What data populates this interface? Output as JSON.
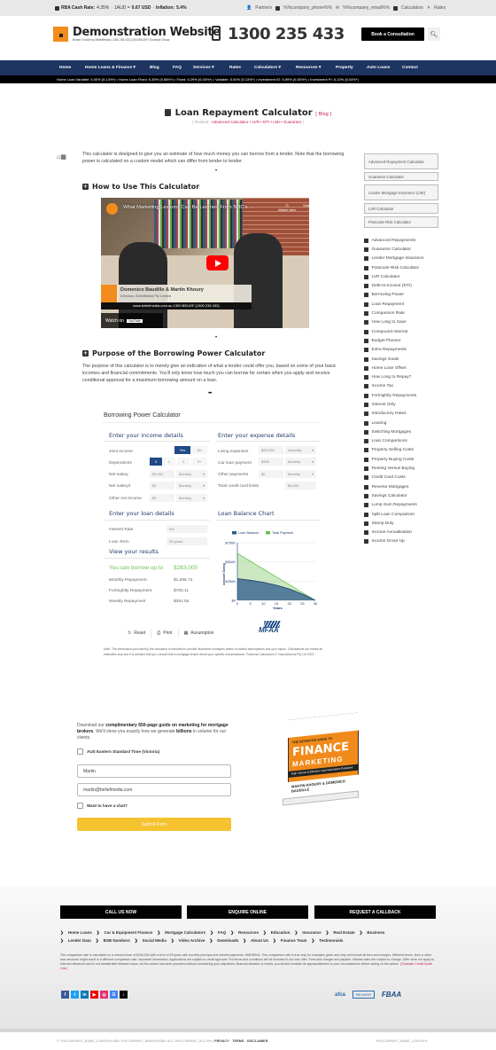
{
  "topbar": {
    "rba_label": "RBA Cash Rate:",
    "rba_value": "4.35%",
    "aud_label": "1AUD =",
    "aud_value": "0.67 USD",
    "inflation_label": "Inflation:",
    "inflation_value": "5.4%",
    "links": [
      "Partners",
      "%%company_phone%%",
      "%%company_email%%",
      "Calculators",
      "Rates"
    ]
  },
  "header": {
    "site_title": "Demonstration Website",
    "site_subtitle": "Broker Growth by BeliefMedia | 1300 235 433 (1300 BELIEF) Example Group",
    "phone": "1300 235 433",
    "book_button": "Book a Consultation",
    "search_icon": "search-icon"
  },
  "nav": {
    "items": [
      "Home",
      "Home Loans & Finance ▾",
      "Blog",
      "FAQ",
      "Services ▾",
      "Rates",
      "Calculators ▾",
      "Resources ▾",
      "Property",
      "Auto Loans",
      "Contact"
    ]
  },
  "ticker": {
    "text": "Home Loan Variable: 5.00% (5.13%*) • Home Loan Fixed: 5.39% (5.68%*) • Fixed: 5.29% (6.03%*) • Variable: 5.00% (5.13%*) • Investment IO: 5.59% (6.50%*) • Investment PI: 5.10% (6.04%*)"
  },
  "page": {
    "title": "Loan Repayment Calculator",
    "blog_tag": "[ Blog ]",
    "related_prefix": "[ Related :",
    "related_links": "Advanced Calculator • LVR • DTI • LMI • Guarantor",
    "related_suffix": "]",
    "intro": "This calculator is designed to give you an estimate of how much money you can borrow from a lender. Note that the borrowing power is calculated on a custom model which can differ from lender to lender.",
    "how_to_heading": "How to Use This Calculator",
    "purpose_heading": "Purpose of the Borrowing Power Calculator",
    "purpose_text": "The purpose of this calculator is to merely give an indication of what a lender could offer you, based on some of your basic incomes and financial commitments. You'll only know how much you can borrow for certain when you apply and receive conditional approval for a maximum borrowing amount on a loan.",
    "bullet": "•",
    "ellipsis": "•••"
  },
  "video": {
    "title": "What Marketing Lessons Can Be Learned From NBC's ...",
    "watch_later": "Watch later",
    "share": "Share",
    "names": "Domenico Baudille & Martin Khoury",
    "directors": "Directors, BeliefMedia Pty Limited",
    "url_bar": "www.beliefmedia.com.au 1300 BELIEF (1300 235 433)",
    "watch_on": "Watch on",
    "youtube": "YouTube"
  },
  "calculator": {
    "title": "Borrowing Power Calculator",
    "income_heading": "Enter your income details",
    "expense_heading": "Enter your expense details",
    "loan_heading": "Enter your loan details",
    "chart_heading": "Loan Balance Chart",
    "results_heading": "View your results",
    "income": {
      "joint_label": "Joint income",
      "joint_options": [
        "Yes",
        "No"
      ],
      "joint_selected": "Yes",
      "dependents_label": "Dependents",
      "dependents_options": [
        "0",
        "1",
        "2",
        "3+"
      ],
      "dependents_selected": "0",
      "net_salary_label": "Net salary",
      "net_salary_value": "$5,000",
      "net_salary_freq": "Monthly",
      "net_salary2_label": "Net salary2",
      "net_salary2_value": "$0",
      "net_salary2_freq": "Monthly",
      "other_label": "Other net income",
      "other_value": "$0",
      "other_freq": "Monthly"
    },
    "expenses": {
      "living_label": "Living expenses",
      "living_value": "$26,328",
      "living_freq": "Annually",
      "car_label": "Car loan payment",
      "car_value": "$300",
      "car_freq": "Monthly",
      "other_label": "Other payments",
      "other_value": "$0",
      "other_freq": "Monthly",
      "cc_label": "Total credit card limits",
      "cc_value": "$5,000"
    },
    "loan": {
      "rate_label": "Interest Rate",
      "rate_value": "6%",
      "term_label": "Loan Term",
      "term_value": "30 years"
    },
    "results": {
      "borrow_label": "You can borrow up to",
      "borrow_value": "$283,000",
      "monthly_label": "Monthly Repayment",
      "monthly_value": "$1,696.73",
      "fortnightly_label": "Fortnightly Repayment",
      "fortnightly_value": "$783.11",
      "weekly_label": "Weekly Repayment",
      "weekly_value": "$391.55"
    },
    "actions": [
      "Reset",
      "Print",
      "Assumption"
    ],
    "mfaa": "MFAA",
    "note": "Note: The information provided by the calculator is intended to provide illustrative examples based on stated assumptions and your inputs. Calculations are meant as estimates only and it is advised that you consult with a mortgage broker about your specific circumstances. Financial Calculators © VisionAbacus Pty Ltd 2023"
  },
  "chart_data": {
    "type": "area",
    "title": "Loan Balance Chart",
    "xlabel": "Years",
    "ylabel": "Amount Owing",
    "x": [
      0,
      5,
      10,
      15,
      20,
      25,
      30
    ],
    "xticks": [
      "0",
      "5",
      "10",
      "15",
      "20",
      "25",
      "30"
    ],
    "yticks": [
      "$0",
      "$250K",
      "$500K",
      "$750K"
    ],
    "ylim": [
      0,
      750000
    ],
    "xlim": [
      0,
      30
    ],
    "legend": "top",
    "grid": true,
    "series": [
      {
        "name": "Loan Balance",
        "color": "#2e5a8e",
        "values": [
          283000,
          262000,
          235000,
          198000,
          148000,
          82000,
          0
        ]
      },
      {
        "name": "Total Payment",
        "color": "#6bbf4e",
        "values": [
          611000,
          509000,
          407000,
          305000,
          204000,
          102000,
          0
        ]
      }
    ]
  },
  "optin": {
    "text_pre": "Download our ",
    "text_bold1": "complimentary 650-page guide on marketing for mortgage brokers",
    "text_mid": ". We'll show you exactly how we generate ",
    "text_bold2": "billions",
    "text_post": " in volume for our clients.",
    "tz_label": "AUS Eastern Standard Time (Victoria)",
    "name_value": "Martin",
    "email_value": "martin@beliefmedia.com",
    "chat_label": "Want to have a chat?",
    "submit": "Submit Form"
  },
  "book": {
    "line1": "THE DEFINITIVE GUIDE TO",
    "line2": "FINANCE",
    "line3": "MARKETING",
    "band": "High Volume & Effective Lead Generation Explained",
    "authors": "MARTIN KHOURY & DOMENICO BAUDILLE"
  },
  "sidebar": {
    "boxes": [
      "Advanced Repayment Calculator",
      "Guarantor Calculator",
      "Lender Mortgage Insurance (LMI)",
      "LVR Calculator",
      "Postcode Risk Calculator"
    ],
    "links": [
      "Advanced Repayments",
      "Guarantor Calculator",
      "Lender Mortgage Insurance",
      "Postcode Risk Calculator",
      "LVR Calculator",
      "Debt-to-Income (DTI)",
      "Borrowing Power",
      "Loan Repayment",
      "Comparison Rate",
      "How Long to Save",
      "Compound Interest",
      "Budget Planner",
      "Extra Repayments",
      "Savings Goals",
      "Home Loan Offset",
      "How Long to Repay?",
      "Income Tax",
      "Fortnightly Repayments",
      "Interest Only",
      "Introductory Rates",
      "Leasing",
      "Switching Mortgages",
      "Loan Comparisons",
      "Property Selling Costs",
      "Property Buying Costs",
      "Renting Versus Buying",
      "Credit Card Costs",
      "Reverse Mortgages",
      "Savings Calculator",
      "Lump Sum Repayments",
      "Split Loan Comparison",
      "Stamp Duty",
      "Income Annualisation",
      "Income Gross Up"
    ]
  },
  "footer": {
    "cta": [
      "CALL US NOW",
      "ENQUIRE ONLINE",
      "REQUEST A CALLBACK"
    ],
    "links_row1": [
      "Home Loans",
      "Car & Equipment Finance",
      "Mortgage Calculators",
      "FAQ",
      "Resources",
      "Education",
      "Insurance",
      "Real Estate",
      "Business"
    ],
    "links_row2": [
      "Lender Data",
      "BSB Numbers",
      "Social Media",
      "Video Archive",
      "Downloads",
      "About Us",
      "Finance Team",
      "Testimonials"
    ],
    "disclaimer": "The comparison rate is calculated on a secured loan of $150,000 with a term of 25 years with monthly principal and interest payments. WARNING: This comparison rate is true only for examples given and may not include all fees and charges. Different terms, fees or other loan amounts might result in a different comparison rate. Important Information: Applications are subject to credit approval. Full terms and conditions will be included in our loan offer. Fees and charges are payable. Interest rates are subject to change. Offer does not apply to internal refinances and is not transferable between loans. As this advice has been prepared without considering your objectives, financial situation or needs, you should consider its appropriateness to your circumstances before acting on the advice.",
    "disclaimer_link": "[ Example Credit Guide Link ]",
    "socials": [
      "f",
      "t",
      "in",
      "▶",
      "◎",
      "G",
      "♪"
    ],
    "badges": [
      "afca",
      "BROKER",
      "FBAA"
    ],
    "copyright": "© %%COMPANY_NAME_LONG%% ABN %%COMPANY_ABN%% ABN: ACL %%COMPANY_ACL%% |",
    "privacy": "PRIVACY",
    "terms": "TERMS",
    "disclaimer_lbl": "DISCLAIMER",
    "right": "%%COMPANY_NAME_LONG%%"
  }
}
